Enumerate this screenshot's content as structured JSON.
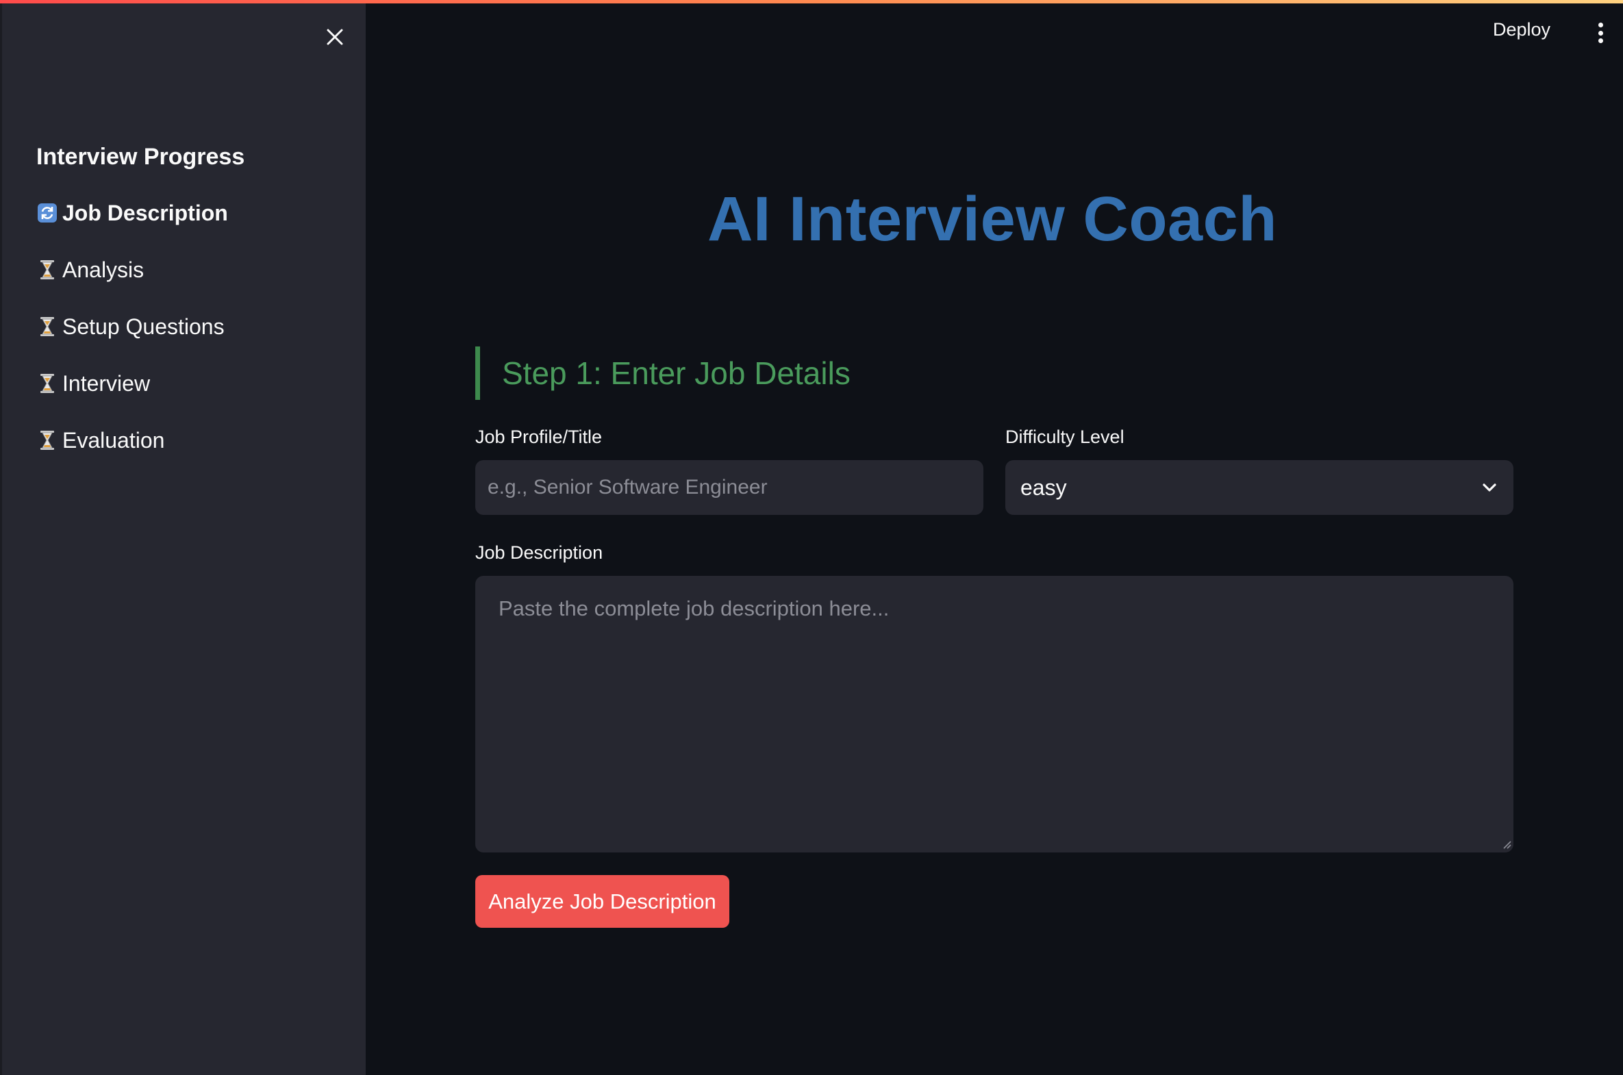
{
  "header": {
    "deploy_label": "Deploy",
    "menu_icon": "kebab-menu-icon"
  },
  "sidebar": {
    "close_icon": "close-icon",
    "title": "Interview Progress",
    "steps": [
      {
        "label": "Job Description",
        "icon": "refresh-icon",
        "status": "active"
      },
      {
        "label": "Analysis",
        "icon": "hourglass-icon",
        "status": "pending"
      },
      {
        "label": "Setup Questions",
        "icon": "hourglass-icon",
        "status": "pending"
      },
      {
        "label": "Interview",
        "icon": "hourglass-icon",
        "status": "pending"
      },
      {
        "label": "Evaluation",
        "icon": "hourglass-icon",
        "status": "pending"
      }
    ]
  },
  "main": {
    "title": "AI Interview Coach",
    "step_header": "Step 1: Enter Job Details",
    "job_title": {
      "label": "Job Profile/Title",
      "value": "",
      "placeholder": "e.g., Senior Software Engineer"
    },
    "difficulty": {
      "label": "Difficulty Level",
      "selected": "easy"
    },
    "job_description": {
      "label": "Job Description",
      "value": "",
      "placeholder": "Paste the complete job description here..."
    },
    "analyze_button": "Analyze Job Description"
  },
  "colors": {
    "background": "#0e1117",
    "sidebar": "#262730",
    "title": "#3470b0",
    "step_header": "#4a9b5c",
    "primary_button": "#ef5350"
  }
}
